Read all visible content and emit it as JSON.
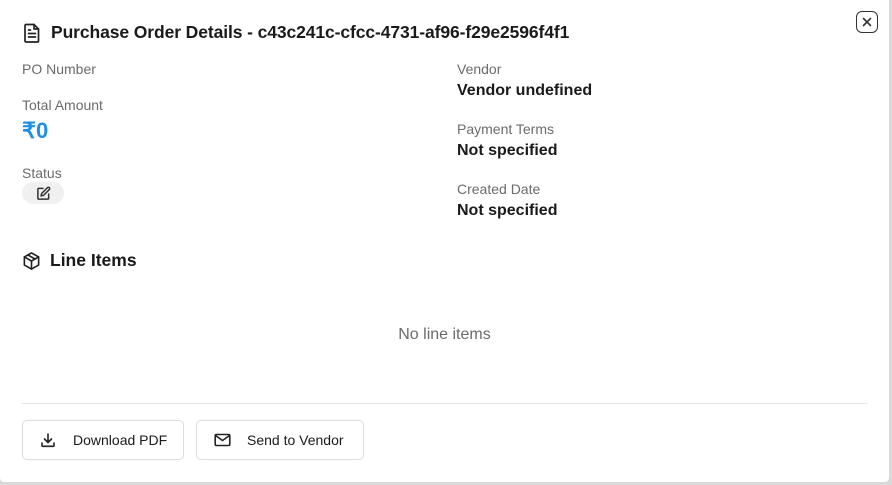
{
  "dialog": {
    "title": "Purchase Order Details - c43c241c-cfcc-4731-af96-f29e2596f4f1",
    "close_icon": "close-icon",
    "title_icon": "document-icon"
  },
  "details_left": {
    "po_number_label": "PO Number",
    "total_amount_label": "Total Amount",
    "total_amount_value": "₹0",
    "status_label": "Status",
    "status_icon": "edit-icon"
  },
  "details_right": {
    "vendor_label": "Vendor",
    "vendor_value": "Vendor undefined",
    "payment_terms_label": "Payment Terms",
    "payment_terms_value": "Not specified",
    "created_date_label": "Created Date",
    "created_date_value": "Not specified"
  },
  "line_items": {
    "title": "Line Items",
    "icon": "package-icon",
    "empty_text": "No line items"
  },
  "actions": {
    "download_label": "Download PDF",
    "download_icon": "download-icon",
    "send_label": "Send to Vendor",
    "send_icon": "mail-icon"
  },
  "colors": {
    "amount": "#1f8fe5"
  }
}
